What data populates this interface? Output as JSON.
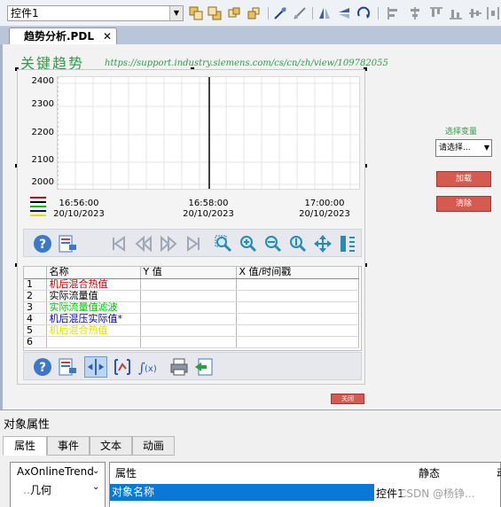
{
  "toolbar": {
    "object_combo_value": "控件1"
  },
  "document": {
    "tab_label": "趋势分析.PDL",
    "close_glyph": "✕"
  },
  "page": {
    "title": "关键趋势",
    "support_url": "https://support.industry.siemens.com/cs/cn/zh/view/109782055"
  },
  "trend": {
    "y_ticks": [
      "2400",
      "2300",
      "2200",
      "2100",
      "2000"
    ],
    "x_ticks": [
      {
        "time": "16:56:00",
        "date": "20/10/2023"
      },
      {
        "time": "16:58:00",
        "date": "20/10/2023"
      },
      {
        "time": "17:00:00",
        "date": "20/10/2023"
      }
    ],
    "legend_colors": [
      "#c00000",
      "#000000",
      "#00c000",
      "#0000c0",
      "#e0e000"
    ]
  },
  "value_table": {
    "headers": [
      "名称",
      "Y 值",
      "X 值/时间戳"
    ],
    "rows": [
      {
        "no": "1",
        "name": "机后混合热值",
        "color": "#c00000"
      },
      {
        "no": "2",
        "name": "实际流量值",
        "color": "#000000"
      },
      {
        "no": "3",
        "name": "实际流量值滤波",
        "color": "#00c000"
      },
      {
        "no": "4",
        "name": "机后混压实际值*",
        "color": "#0000c0"
      },
      {
        "no": "5",
        "name": "机后混合热值",
        "color": "#e0e000"
      },
      {
        "no": "6",
        "name": "",
        "color": "#000000"
      }
    ]
  },
  "right_panel": {
    "select_label": "选择变量",
    "select_value": "请选择...",
    "add_button": "加载",
    "clear_button": "清除",
    "back_button": "关闭"
  },
  "properties": {
    "panel_title": "对象属性",
    "tabs": [
      "属性",
      "事件",
      "文本",
      "动画"
    ],
    "tree_root": "AxOnlineTrend",
    "tree_child": "几何",
    "col_attr": "属性",
    "col_static": "静态",
    "col_dynamic": "动",
    "selected_attr": "对象名称",
    "selected_value": "控件1"
  },
  "watermark": "CSDN @杨铮...",
  "colors": {
    "accent_green": "#2e9a4a",
    "button_red": "#d65a50",
    "selection_blue": "#0a78d7"
  }
}
